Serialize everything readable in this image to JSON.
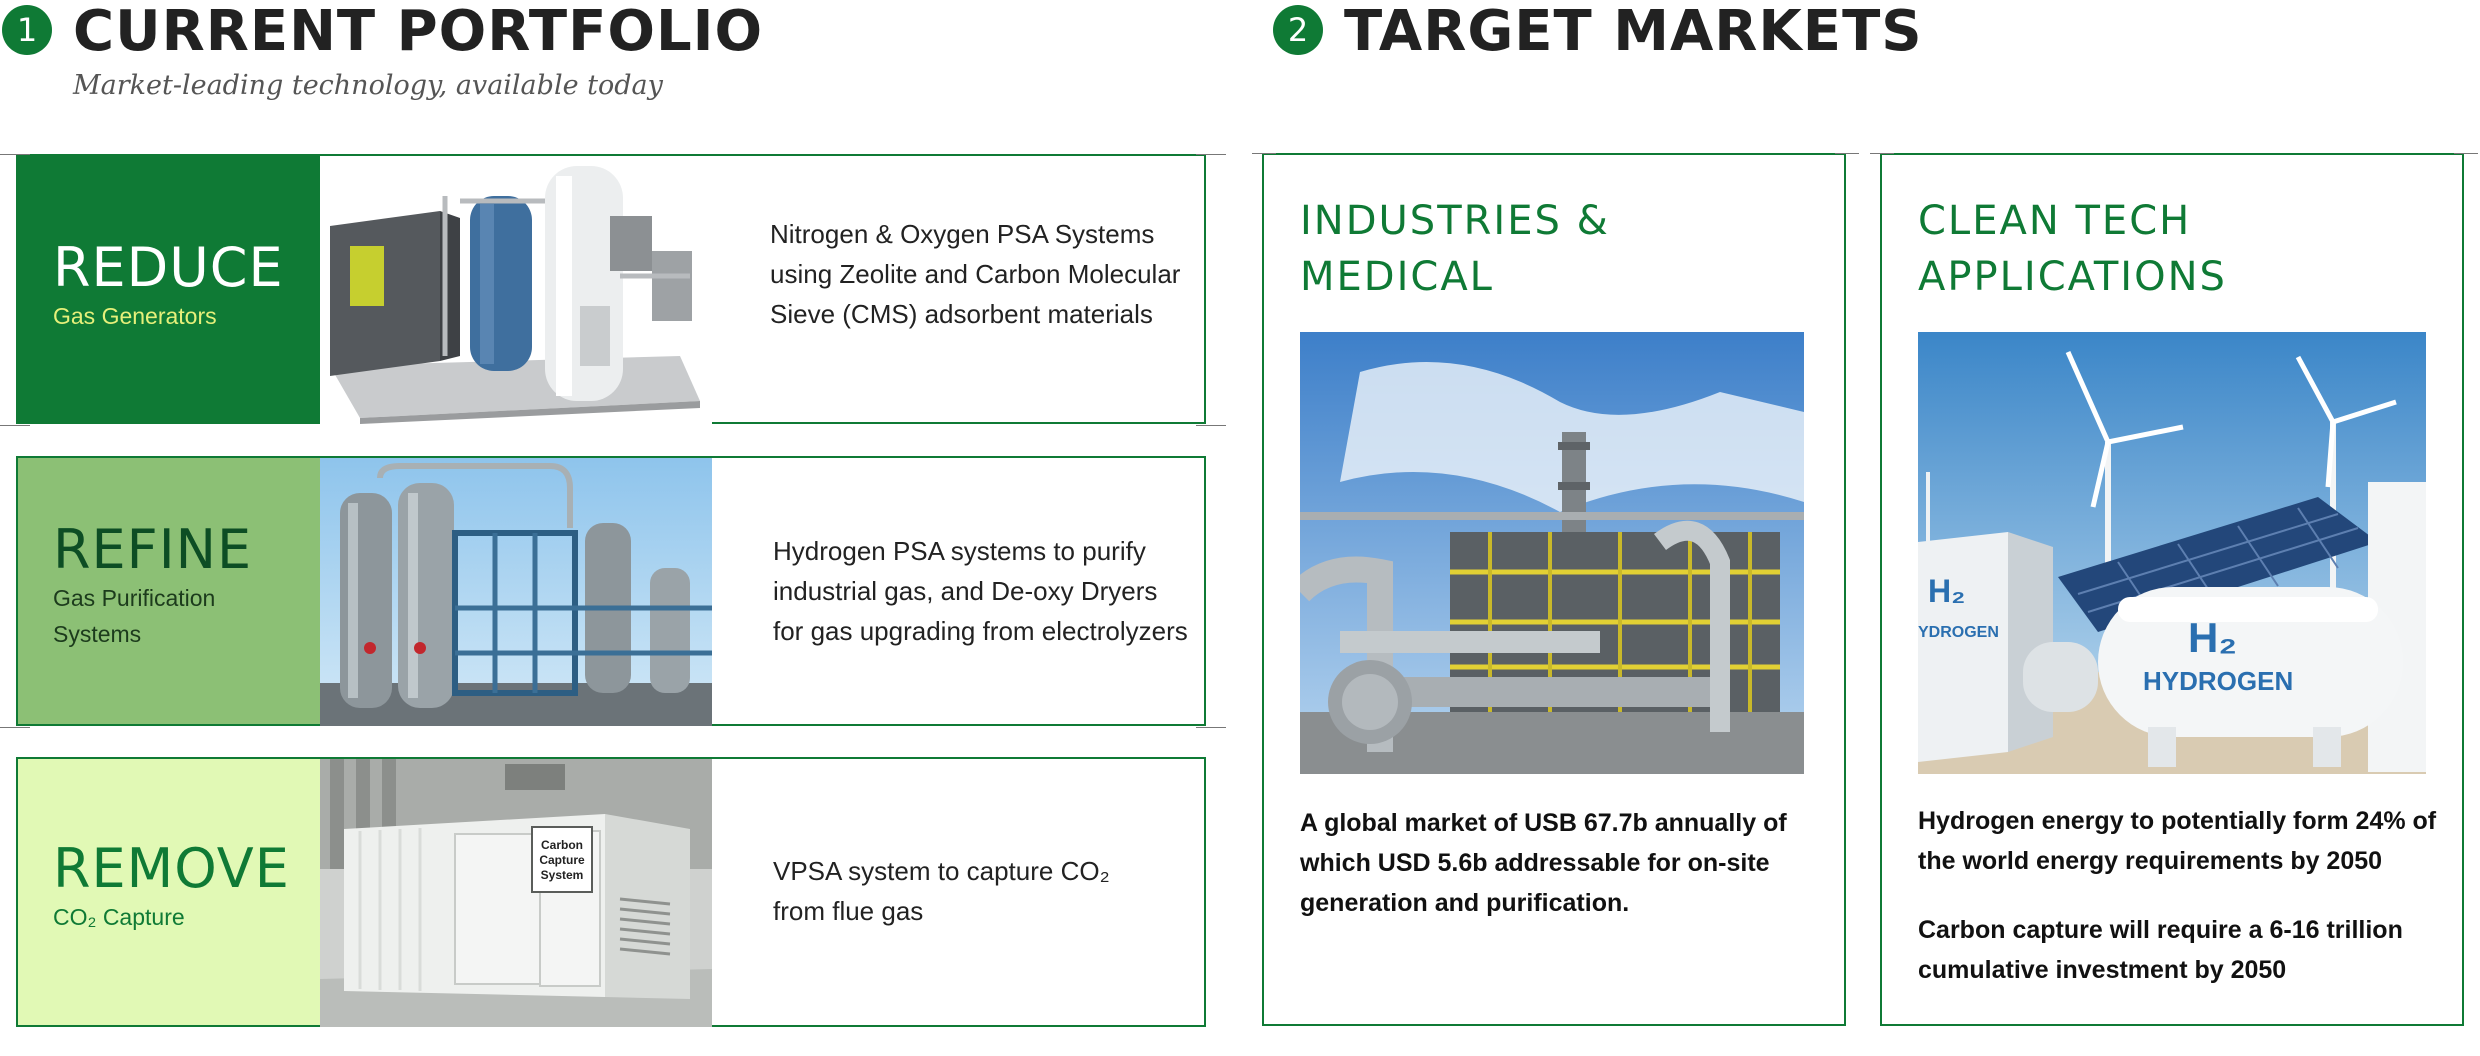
{
  "portfolio": {
    "number": "1",
    "title": "CURRENT PORTFOLIO",
    "subtitle": "Market-leading technology, available today",
    "rows": [
      {
        "title": "REDUCE",
        "subtitle": "Gas Generators",
        "description": "Nitrogen & Oxygen PSA Systems using Zeolite and Carbon Molecular Sieve (CMS) adsorbent materials",
        "block_color": "#0f7a35",
        "title_color": "#ffffff",
        "subtitle_color": "#e6f07a"
      },
      {
        "title": "REFINE",
        "subtitle": "Gas Purification Systems",
        "description": "Hydrogen PSA systems to purify industrial gas, and De-oxy Dryers for gas upgrading from electrolyzers",
        "block_color": "#8cc075",
        "title_color": "#0d4d24",
        "subtitle_color": "#1c3b1c"
      },
      {
        "title": "REMOVE",
        "subtitle": "CO₂ Capture",
        "description": "VPSA system to capture CO₂ from flue gas",
        "block_color": "#e1f9b5",
        "title_color": "#0f7a35",
        "subtitle_color": "#0f7a35",
        "container_text": [
          "Carbon",
          "Capture",
          "System"
        ]
      }
    ]
  },
  "markets": {
    "number": "2",
    "title": "TARGET MARKETS",
    "cards": [
      {
        "title": "INDUSTRIES & MEDICAL",
        "paragraphs": [
          "A global market of USB 67.7b annually of which USD 5.6b addressable for on-site generation and purification."
        ]
      },
      {
        "title": "CLEAN TECH APPLICATIONS",
        "paragraphs": [
          "Hydrogen energy to potentially form 24% of the world energy requirements by 2050",
          "Carbon capture will require a 6-16 trillion cumulative investment by 2050"
        ],
        "photo_text": [
          "H₂",
          "HYDROGEN",
          "H₂",
          "YDROGEN"
        ]
      }
    ]
  },
  "colors": {
    "brand_green": "#0f7a35"
  }
}
